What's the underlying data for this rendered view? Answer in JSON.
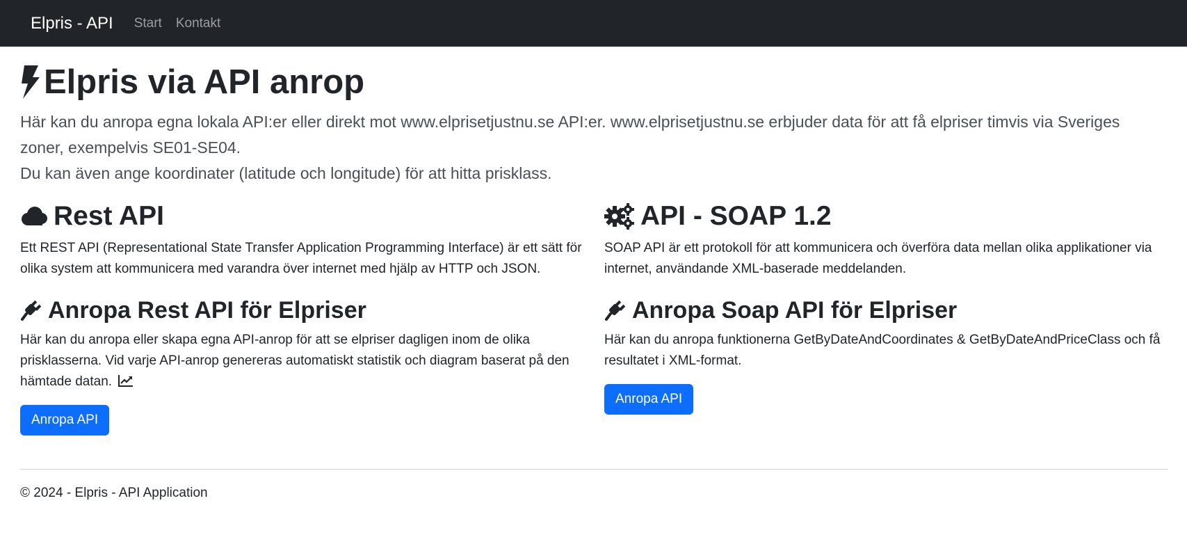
{
  "navbar": {
    "brand": "Elpris - API",
    "links": [
      "Start",
      "Kontakt"
    ]
  },
  "hero": {
    "title": "Elpris via API anrop",
    "lead_line1": "Här kan du anropa egna lokala API:er eller direkt mot www.elprisetjustnu.se API:er. www.elprisetjustnu.se erbjuder data för att få elpriser timvis via Sveriges zoner, exempelvis SE01-SE04.",
    "lead_line2": "Du kan även ange koordinater (latitude och longitude) för att hitta prisklass."
  },
  "rest": {
    "title": "Rest API",
    "description": "Ett REST API (Representational State Transfer Application Programming Interface) är ett sätt för olika system att kommunicera med varandra över internet med hjälp av HTTP och JSON.",
    "call_title": "Anropa Rest API för Elpriser",
    "call_description": "Här kan du anropa eller skapa egna API-anrop för att se elpriser dagligen inom de olika prisklasserna. Vid varje API-anrop genereras automatiskt statistik och diagram baserat på den hämtade datan.",
    "button": "Anropa API"
  },
  "soap": {
    "title": "API - SOAP 1.2",
    "description": "SOAP API är ett protokoll för att kommunicera och överföra data mellan olika applikationer via internet, användande XML-baserade meddelanden.",
    "call_title": "Anropa Soap API för Elpriser",
    "call_description": "Här kan du anropa funktionerna GetByDateAndCoordinates & GetByDateAndPriceClass och få resultatet i XML-format.",
    "button": "Anropa API"
  },
  "footer": {
    "text": "© 2024 - Elpris - API Application"
  },
  "icons": {
    "hero": "lightning-bolt-icon",
    "rest": "cloud-icon",
    "soap": "gears-icon",
    "call": "plug-icon",
    "chart": "line-chart-icon"
  },
  "colors": {
    "navbar_bg": "#212529",
    "primary_button": "#0d6efd",
    "text": "#212529"
  }
}
